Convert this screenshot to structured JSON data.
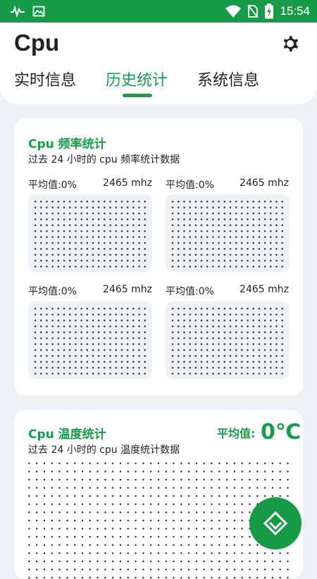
{
  "status_bar": {
    "time": "15:54",
    "icons": [
      "activity-icon",
      "image-icon",
      "wifi-icon",
      "no-sim-icon",
      "battery-charging-icon"
    ]
  },
  "header": {
    "title": "Cpu",
    "settings_icon": "gear-icon",
    "tabs": [
      {
        "label": "实时信息",
        "active": false
      },
      {
        "label": "历史统计",
        "active": true
      },
      {
        "label": "系统信息",
        "active": false
      }
    ],
    "accent_color": "#1a9a4b"
  },
  "frequency_card": {
    "title": "Cpu 频率统计",
    "subtitle": "过去 24 小时的 cpu 频率统计数据",
    "plots": [
      {
        "avg_label": "平均值:0%",
        "freq": "2465 mhz"
      },
      {
        "avg_label": "平均值:0%",
        "freq": "2465 mhz"
      },
      {
        "avg_label": "平均值:0%",
        "freq": "2465 mhz"
      },
      {
        "avg_label": "平均值:0%",
        "freq": "2465 mhz"
      }
    ]
  },
  "temperature_card": {
    "title": "Cpu 温度统计",
    "subtitle": "过去 24 小时的 cpu 温度统计数据",
    "avg_label": "平均值:",
    "avg_value": "0℃"
  },
  "fab": {
    "icon": "chevron-down-icon"
  }
}
